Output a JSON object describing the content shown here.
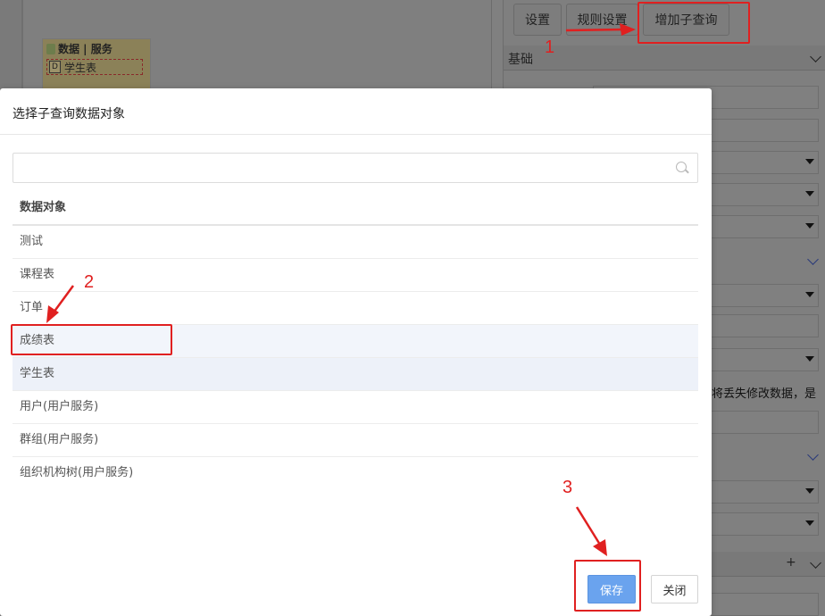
{
  "background": {
    "entity": {
      "header": "数据 | 服务",
      "row_icon_letter": "D",
      "row_label": "学生表"
    },
    "toolbar": {
      "settings": "设置",
      "rule_settings": "规则设置",
      "add_subquery": "增加子查询"
    },
    "section_label": "基础",
    "partial_text": "将丢失修改数据，是",
    "plus": "+"
  },
  "modal": {
    "title": "选择子查询数据对象",
    "search": {
      "value": "",
      "placeholder": ""
    },
    "list_header": "数据对象",
    "items": [
      {
        "label": "测试"
      },
      {
        "label": "课程表"
      },
      {
        "label": "订单"
      },
      {
        "label": "成绩表"
      },
      {
        "label": "学生表"
      },
      {
        "label": "用户(用户服务)"
      },
      {
        "label": "群组(用户服务)"
      },
      {
        "label": "组织机构树(用户服务)"
      }
    ],
    "save_label": "保存",
    "close_label": "关闭"
  },
  "annotations": {
    "n1": "1",
    "n2": "2",
    "n3": "3"
  },
  "colors": {
    "highlight": "#e02020",
    "primary": "#6aa3ee"
  }
}
